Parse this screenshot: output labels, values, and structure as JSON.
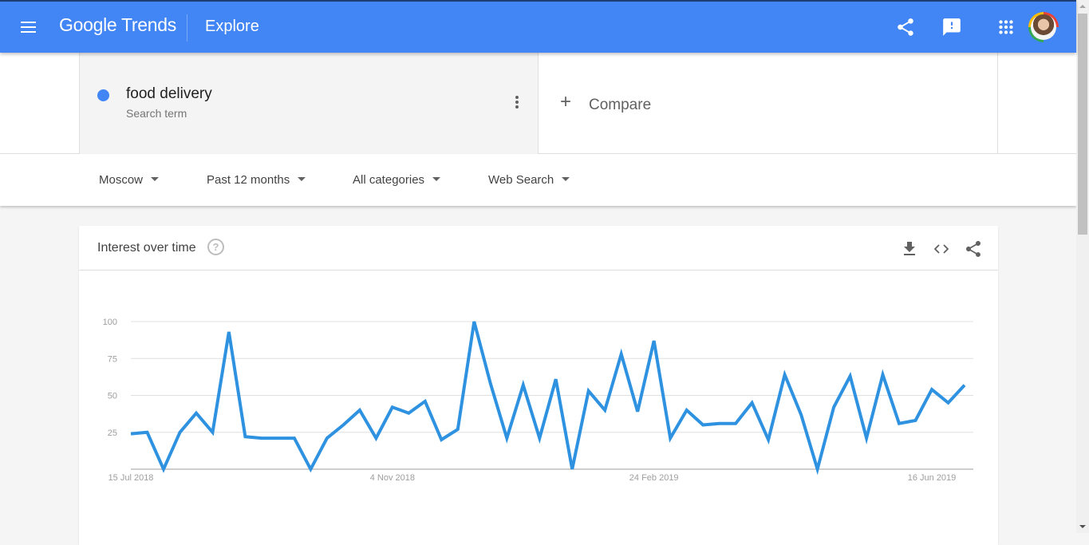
{
  "header": {
    "logo_text": "Google Trends",
    "page_title": "Explore",
    "icons": [
      "menu-icon",
      "share-icon",
      "feedback-icon",
      "apps-grid-icon",
      "account-avatar"
    ]
  },
  "search": {
    "term": "food delivery",
    "term_type": "Search term",
    "term_color": "#4285f4",
    "compare_label": "Compare"
  },
  "filters": {
    "region": "Moscow",
    "time_range": "Past 12 months",
    "category": "All categories",
    "property": "Web Search"
  },
  "card": {
    "title": "Interest over time",
    "help_label": "?",
    "actions": [
      "download-icon",
      "embed-icon",
      "share-icon"
    ]
  },
  "chart_data": {
    "type": "line",
    "title": "Interest over time",
    "xlabel": "",
    "ylabel": "",
    "ylim": [
      0,
      100
    ],
    "yticks": [
      25,
      50,
      75,
      100
    ],
    "xtick_labels": [
      {
        "label": "15 Jul 2018",
        "index": 0
      },
      {
        "label": "4 Nov 2018",
        "index": 16
      },
      {
        "label": "24 Feb 2019",
        "index": 32
      },
      {
        "label": "16 Jun 2019",
        "index": 49
      }
    ],
    "grid": true,
    "series": [
      {
        "name": "food delivery",
        "color": "#2e92e0",
        "values": [
          24,
          25,
          0,
          25,
          38,
          25,
          93,
          22,
          21,
          21,
          21,
          0,
          21,
          30,
          40,
          21,
          42,
          38,
          46,
          20,
          27,
          100,
          58,
          21,
          57,
          21,
          61,
          0,
          53,
          40,
          78,
          39,
          87,
          21,
          40,
          30,
          31,
          31,
          45,
          20,
          64,
          37,
          0,
          42,
          63,
          21,
          64,
          31,
          33,
          54,
          45,
          57
        ]
      }
    ]
  }
}
